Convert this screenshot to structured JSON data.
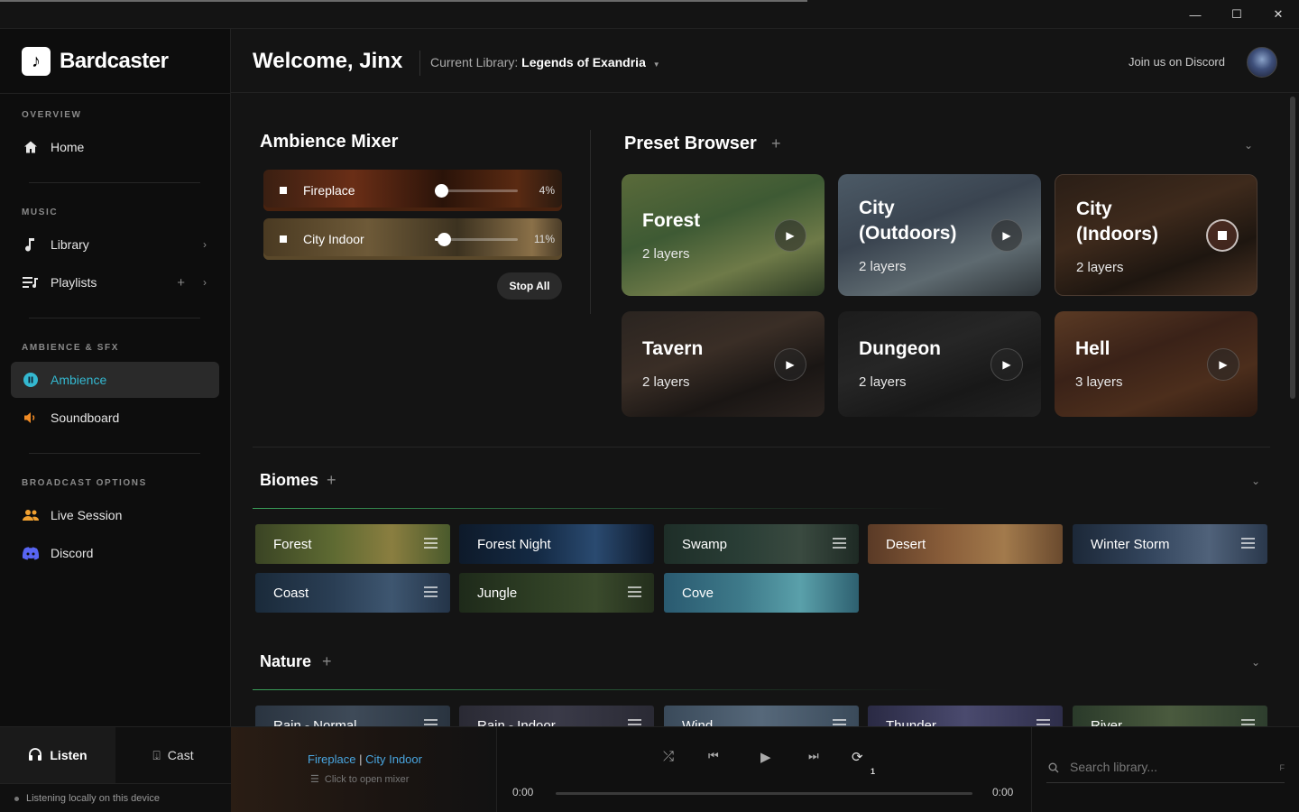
{
  "app": {
    "name": "Bardcaster"
  },
  "window_controls": {
    "minimize": "—",
    "maximize": "☐",
    "close": "✕"
  },
  "sidebar": {
    "sections": {
      "overview": "OVERVIEW",
      "music": "MUSIC",
      "ambience": "AMBIENCE & SFX",
      "broadcast": "BROADCAST OPTIONS"
    },
    "items": {
      "home": "Home",
      "library": "Library",
      "playlists": "Playlists",
      "ambience": "Ambience",
      "soundboard": "Soundboard",
      "live_session": "Live Session",
      "discord": "Discord"
    }
  },
  "header": {
    "welcome": "Welcome, Jinx",
    "library_label": "Current Library:",
    "library_name": "Legends of Exandria",
    "discord_link": "Join us on Discord"
  },
  "mixer": {
    "title": "Ambience Mixer",
    "layers": [
      {
        "name": "Fireplace",
        "percent": "4%",
        "level": 0.04
      },
      {
        "name": "City Indoor",
        "percent": "11%",
        "level": 0.11
      }
    ],
    "stop_all": "Stop All"
  },
  "presets": {
    "title": "Preset Browser",
    "items": [
      {
        "title": "Forest",
        "layers": "2 layers",
        "state": "play"
      },
      {
        "title": "City (Outdoors)",
        "layers": "2 layers",
        "state": "play"
      },
      {
        "title": "City (Indoors)",
        "layers": "2 layers",
        "state": "stop"
      },
      {
        "title": "Tavern",
        "layers": "2 layers",
        "state": "play"
      },
      {
        "title": "Dungeon",
        "layers": "2 layers",
        "state": "play"
      },
      {
        "title": "Hell",
        "layers": "3 layers",
        "state": "play"
      }
    ]
  },
  "biomes": {
    "title": "Biomes",
    "items": [
      "Forest",
      "Forest Night",
      "Swamp",
      "Desert",
      "Winter Storm",
      "Coast",
      "Jungle",
      "Cove"
    ]
  },
  "nature": {
    "title": "Nature",
    "items": [
      "Rain - Normal",
      "Rain - Indoor",
      "Wind",
      "Thunder",
      "River"
    ]
  },
  "footer": {
    "listen": "Listen",
    "cast": "Cast",
    "status": "Listening locally on this device",
    "np_part1": "Fireplace",
    "np_sep": "|",
    "np_part2": "City Indoor",
    "np_sub": "Click to open mixer",
    "time_current": "0:00",
    "time_total": "0:00",
    "repeat_badge": "1",
    "search_placeholder": "Search library...",
    "search_hint": "F"
  }
}
